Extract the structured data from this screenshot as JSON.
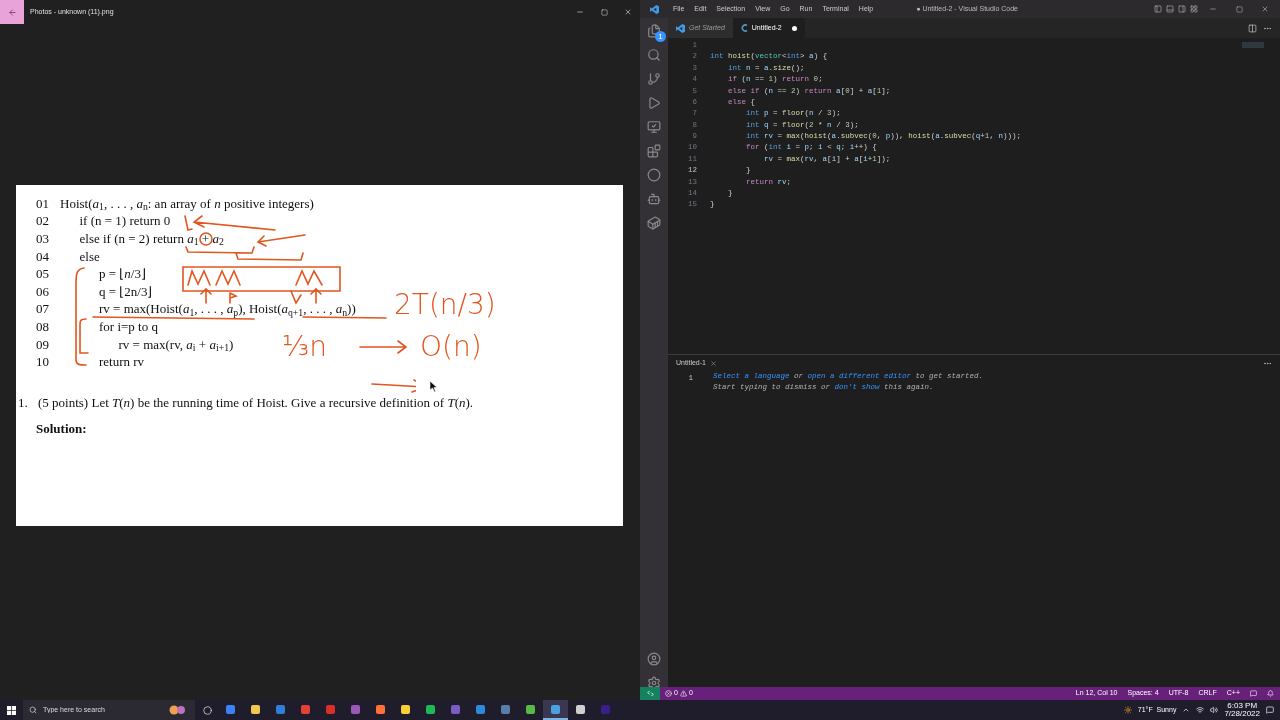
{
  "photos": {
    "title": "Photos - unknown (11).png",
    "document": {
      "lines": [
        {
          "number": "01",
          "text": "Hoist(*a*$_{1}$, . . . , *a*$_{n}$: an array of *n* positive integers)",
          "children": [
            {
              "number": "02",
              "text": "if (n = 1) return 0"
            },
            {
              "number": "03",
              "text": "else if (n = 2) return *a*$_{1}$ + *a*$_{2}$"
            },
            {
              "number": "04",
              "text": "else",
              "children": [
                {
                  "number": "05",
                  "text": "p = ⌊*n*/3⌋"
                },
                {
                  "number": "06",
                  "text": "q = ⌊2n/3⌋"
                },
                {
                  "number": "07",
                  "text": "rv = max(Hoist(*a*$_{1}$, . . . , *a*$_{p}$), Hoist(*a*$_{q+1}$, . . . , *a*$_{n}$))"
                },
                {
                  "number": "08",
                  "text": "for i=p to q",
                  "children": [
                    {
                      "number": "09",
                      "text": "rv = max(rv, *a*$_{i}$ + *a*$_{i+1}$)"
                    }
                  ]
                },
                {
                  "number": "10",
                  "text": "return rv"
                }
              ]
            }
          ]
        }
      ],
      "question": {
        "number": "1.",
        "text": "(5 points) Let *T*(*n*) be the running time of Hoist. Give a recursive definition of *T*(*n*)."
      },
      "solution_label": "Solution:",
      "ink_notes": [
        "2T(n/3)",
        "⅓n",
        "O(n)"
      ]
    }
  },
  "vscode": {
    "title": "● Untitled-2 - Visual Studio Code",
    "menu": [
      "File",
      "Edit",
      "Selection",
      "View",
      "Go",
      "Run",
      "Terminal",
      "Help"
    ],
    "explorer_badge": "1",
    "tabs": [
      {
        "label": "Get Started",
        "kind": "welcome",
        "selected": false,
        "dirty": false
      },
      {
        "label": "Untitled-2",
        "kind": "cpp",
        "selected": true,
        "dirty": true
      }
    ],
    "code": [
      {
        "number": "1"
      },
      {
        "number": "2",
        "tokens": [
          {
            "kind": "keyword",
            "text": "int "
          },
          {
            "kind": "function",
            "text": "hoist"
          },
          {
            "kind": "plain",
            "text": "("
          },
          {
            "kind": "type",
            "text": "vector"
          },
          {
            "kind": "plain",
            "text": "<"
          },
          {
            "kind": "keyword",
            "text": "int"
          },
          {
            "kind": "plain",
            "text": "> "
          },
          {
            "kind": "variable",
            "text": "a"
          },
          {
            "kind": "plain",
            "text": ") {"
          }
        ],
        "children": [
          {
            "number": "3",
            "tokens": [
              {
                "kind": "keyword",
                "text": "int "
              },
              {
                "kind": "variable",
                "text": "n"
              },
              {
                "kind": "plain",
                "text": " = "
              },
              {
                "kind": "variable",
                "text": "a"
              },
              {
                "kind": "plain",
                "text": "."
              },
              {
                "kind": "function",
                "text": "size"
              },
              {
                "kind": "plain",
                "text": "();"
              }
            ]
          },
          {
            "number": "4",
            "tokens": [
              {
                "kind": "control",
                "text": "if "
              },
              {
                "kind": "plain",
                "text": "("
              },
              {
                "kind": "variable",
                "text": "n"
              },
              {
                "kind": "plain",
                "text": " == "
              },
              {
                "kind": "number",
                "text": "1"
              },
              {
                "kind": "plain",
                "text": ") "
              },
              {
                "kind": "control",
                "text": "return "
              },
              {
                "kind": "number",
                "text": "0"
              },
              {
                "kind": "plain",
                "text": ";"
              }
            ]
          },
          {
            "number": "5",
            "tokens": [
              {
                "kind": "control",
                "text": "else if "
              },
              {
                "kind": "plain",
                "text": "("
              },
              {
                "kind": "variable",
                "text": "n"
              },
              {
                "kind": "plain",
                "text": " == "
              },
              {
                "kind": "number",
                "text": "2"
              },
              {
                "kind": "plain",
                "text": ") "
              },
              {
                "kind": "control",
                "text": "return "
              },
              {
                "kind": "variable",
                "text": "a"
              },
              {
                "kind": "plain",
                "text": "["
              },
              {
                "kind": "number",
                "text": "0"
              },
              {
                "kind": "plain",
                "text": "] + "
              },
              {
                "kind": "variable",
                "text": "a"
              },
              {
                "kind": "plain",
                "text": "["
              },
              {
                "kind": "number",
                "text": "1"
              },
              {
                "kind": "plain",
                "text": "];"
              }
            ]
          },
          {
            "number": "6",
            "tokens": [
              {
                "kind": "control",
                "text": "else "
              },
              {
                "kind": "plain",
                "text": "{"
              }
            ],
            "children": [
              {
                "number": "7",
                "tokens": [
                  {
                    "kind": "keyword",
                    "text": "int "
                  },
                  {
                    "kind": "variable",
                    "text": "p"
                  },
                  {
                    "kind": "plain",
                    "text": " = "
                  },
                  {
                    "kind": "function",
                    "text": "floor"
                  },
                  {
                    "kind": "plain",
                    "text": "("
                  },
                  {
                    "kind": "variable",
                    "text": "n"
                  },
                  {
                    "kind": "plain",
                    "text": " / "
                  },
                  {
                    "kind": "number",
                    "text": "3"
                  },
                  {
                    "kind": "plain",
                    "text": ");"
                  }
                ]
              },
              {
                "number": "8",
                "tokens": [
                  {
                    "kind": "keyword",
                    "text": "int "
                  },
                  {
                    "kind": "variable",
                    "text": "q"
                  },
                  {
                    "kind": "plain",
                    "text": " = "
                  },
                  {
                    "kind": "function",
                    "text": "floor"
                  },
                  {
                    "kind": "plain",
                    "text": "("
                  },
                  {
                    "kind": "number",
                    "text": "2"
                  },
                  {
                    "kind": "plain",
                    "text": " * "
                  },
                  {
                    "kind": "variable",
                    "text": "n"
                  },
                  {
                    "kind": "plain",
                    "text": " / "
                  },
                  {
                    "kind": "number",
                    "text": "3"
                  },
                  {
                    "kind": "plain",
                    "text": ");"
                  }
                ]
              },
              {
                "number": "9",
                "tokens": [
                  {
                    "kind": "keyword",
                    "text": "int "
                  },
                  {
                    "kind": "variable",
                    "text": "rv"
                  },
                  {
                    "kind": "plain",
                    "text": " = "
                  },
                  {
                    "kind": "function",
                    "text": "max"
                  },
                  {
                    "kind": "plain",
                    "text": "("
                  },
                  {
                    "kind": "function",
                    "text": "hoist"
                  },
                  {
                    "kind": "plain",
                    "text": "("
                  },
                  {
                    "kind": "variable",
                    "text": "a"
                  },
                  {
                    "kind": "plain",
                    "text": "."
                  },
                  {
                    "kind": "function",
                    "text": "subvec"
                  },
                  {
                    "kind": "plain",
                    "text": "("
                  },
                  {
                    "kind": "number",
                    "text": "0"
                  },
                  {
                    "kind": "plain",
                    "text": ", "
                  },
                  {
                    "kind": "variable",
                    "text": "p"
                  },
                  {
                    "kind": "plain",
                    "text": ")), "
                  },
                  {
                    "kind": "function",
                    "text": "hoist"
                  },
                  {
                    "kind": "plain",
                    "text": "("
                  },
                  {
                    "kind": "variable",
                    "text": "a"
                  },
                  {
                    "kind": "plain",
                    "text": "."
                  },
                  {
                    "kind": "function",
                    "text": "subvec"
                  },
                  {
                    "kind": "plain",
                    "text": "("
                  },
                  {
                    "kind": "variable",
                    "text": "q"
                  },
                  {
                    "kind": "plain",
                    "text": "+"
                  },
                  {
                    "kind": "number",
                    "text": "1"
                  },
                  {
                    "kind": "plain",
                    "text": ", "
                  },
                  {
                    "kind": "variable",
                    "text": "n"
                  },
                  {
                    "kind": "plain",
                    "text": ")));"
                  }
                ]
              },
              {
                "number": "10",
                "tokens": [
                  {
                    "kind": "control",
                    "text": "for "
                  },
                  {
                    "kind": "plain",
                    "text": "("
                  },
                  {
                    "kind": "keyword",
                    "text": "int "
                  },
                  {
                    "kind": "variable",
                    "text": "i"
                  },
                  {
                    "kind": "plain",
                    "text": " = "
                  },
                  {
                    "kind": "variable",
                    "text": "p"
                  },
                  {
                    "kind": "plain",
                    "text": "; "
                  },
                  {
                    "kind": "variable",
                    "text": "i"
                  },
                  {
                    "kind": "plain",
                    "text": " < "
                  },
                  {
                    "kind": "variable",
                    "text": "q"
                  },
                  {
                    "kind": "plain",
                    "text": "; "
                  },
                  {
                    "kind": "variable",
                    "text": "i"
                  },
                  {
                    "kind": "plain",
                    "text": "++) {"
                  }
                ],
                "children": [
                  {
                    "number": "11",
                    "tokens": [
                      {
                        "kind": "variable",
                        "text": "rv"
                      },
                      {
                        "kind": "plain",
                        "text": " = "
                      },
                      {
                        "kind": "function",
                        "text": "max"
                      },
                      {
                        "kind": "plain",
                        "text": "("
                      },
                      {
                        "kind": "variable",
                        "text": "rv"
                      },
                      {
                        "kind": "plain",
                        "text": ", "
                      },
                      {
                        "kind": "variable",
                        "text": "a"
                      },
                      {
                        "kind": "plain",
                        "text": "["
                      },
                      {
                        "kind": "variable",
                        "text": "i"
                      },
                      {
                        "kind": "plain",
                        "text": "] + "
                      },
                      {
                        "kind": "variable",
                        "text": "a"
                      },
                      {
                        "kind": "plain",
                        "text": "["
                      },
                      {
                        "kind": "variable",
                        "text": "i"
                      },
                      {
                        "kind": "plain",
                        "text": "+"
                      },
                      {
                        "kind": "number",
                        "text": "1"
                      },
                      {
                        "kind": "plain",
                        "text": "]);"
                      }
                    ]
                  }
                ]
              },
              {
                "number": "12",
                "current": true,
                "tokens": [
                  {
                    "kind": "plain",
                    "text": "}"
                  }
                ]
              },
              {
                "number": "13",
                "tokens": [
                  {
                    "kind": "control",
                    "text": "return "
                  },
                  {
                    "kind": "variable",
                    "text": "rv"
                  },
                  {
                    "kind": "plain",
                    "text": ";"
                  }
                ]
              }
            ]
          },
          {
            "number": "14",
            "tokens": [
              {
                "kind": "plain",
                "text": "}"
              }
            ]
          }
        ]
      },
      {
        "number": "15",
        "tokens": [
          {
            "kind": "plain",
            "text": "}"
          }
        ]
      }
    ],
    "panel": {
      "tab": "Untitled-1",
      "line_number": "1",
      "hint_lines": [
        [
          {
            "text": "Select a language",
            "link": true
          },
          {
            "text": " or ",
            "link": false
          },
          {
            "text": "open a different editor",
            "link": true
          },
          {
            "text": " to get started.",
            "link": false
          }
        ],
        [
          {
            "text": "Start typing to dismiss or ",
            "link": false
          },
          {
            "text": "don't show",
            "link": true
          },
          {
            "text": " this again.",
            "link": false
          }
        ]
      ]
    },
    "status_bar": {
      "errors": "0",
      "warnings": "0",
      "items": [
        "Ln 12, Col 10",
        "Spaces: 4",
        "UTF-8",
        "CRLF",
        "C++"
      ]
    }
  },
  "taskbar": {
    "search_placeholder": "Type here to search",
    "apps": [
      {
        "color": "#3b82f6",
        "selected": false
      },
      {
        "color": "#f2c94c",
        "selected": false
      },
      {
        "color": "#2f7fd6",
        "selected": false
      },
      {
        "color": "#e34133",
        "selected": false
      },
      {
        "color": "#d93025",
        "selected": false
      },
      {
        "color": "#9b59b6",
        "selected": false
      },
      {
        "color": "#ff7139",
        "selected": false
      },
      {
        "color": "#f7d038",
        "selected": false
      },
      {
        "color": "#1db954",
        "selected": false
      },
      {
        "color": "#7c5cc4",
        "selected": false
      },
      {
        "color": "#2c8ad8",
        "selected": false
      },
      {
        "color": "#5a7fa6",
        "selected": false
      },
      {
        "color": "#58b947",
        "selected": false
      },
      {
        "color": "#4aa3df",
        "selected": true
      },
      {
        "color": "#cfcfcf",
        "selected": false
      },
      {
        "color": "#3b1e8a",
        "selected": false
      }
    ],
    "weather": "71°F  Sunny",
    "time": "6:03 PM",
    "date": "7/28/2022"
  }
}
